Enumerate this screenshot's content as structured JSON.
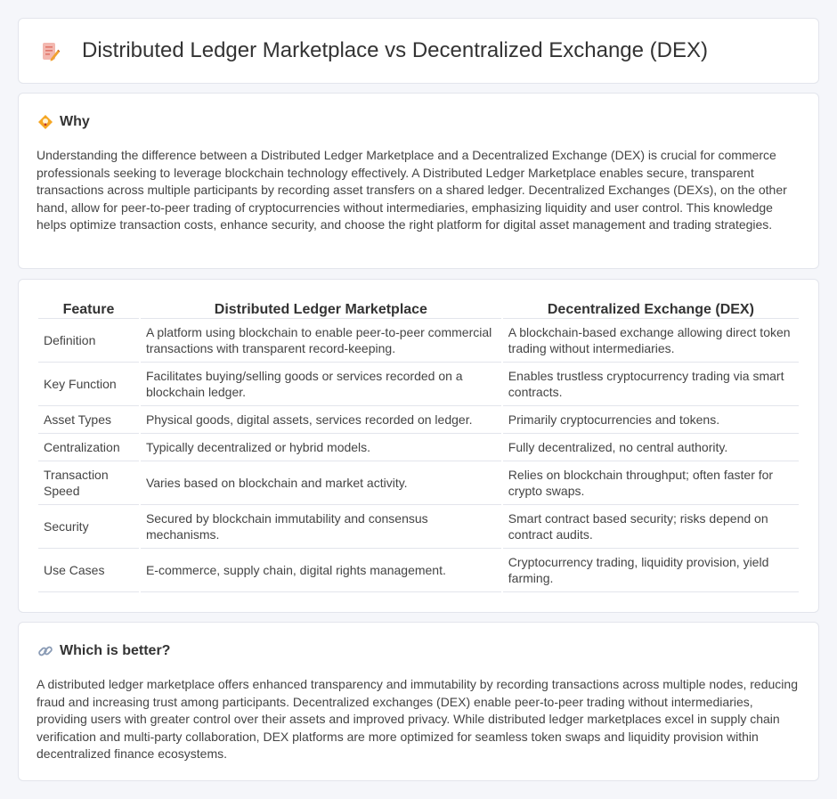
{
  "header": {
    "title": "Distributed Ledger Marketplace vs Decentralized Exchange (DEX)",
    "icon": "document-pencil-icon"
  },
  "why": {
    "title": "Why",
    "icon": "diamond-lightbulb-icon",
    "text": "Understanding the difference between a Distributed Ledger Marketplace and a Decentralized Exchange (DEX) is crucial for commerce professionals seeking to leverage blockchain technology effectively. A Distributed Ledger Marketplace enables secure, transparent transactions across multiple participants by recording asset transfers on a shared ledger. Decentralized Exchanges (DEXs), on the other hand, allow for peer-to-peer trading of cryptocurrencies without intermediaries, emphasizing liquidity and user control. This knowledge helps optimize transaction costs, enhance security, and choose the right platform for digital asset management and trading strategies."
  },
  "table": {
    "headers": [
      "Feature",
      "Distributed Ledger Marketplace",
      "Decentralized Exchange (DEX)"
    ],
    "rows": [
      {
        "feature": "Definition",
        "dlm": "A platform using blockchain to enable peer-to-peer commercial transactions with transparent record-keeping.",
        "dex": "A blockchain-based exchange allowing direct token trading without intermediaries."
      },
      {
        "feature": "Key Function",
        "dlm": "Facilitates buying/selling goods or services recorded on a blockchain ledger.",
        "dex": "Enables trustless cryptocurrency trading via smart contracts."
      },
      {
        "feature": "Asset Types",
        "dlm": "Physical goods, digital assets, services recorded on ledger.",
        "dex": "Primarily cryptocurrencies and tokens."
      },
      {
        "feature": "Centralization",
        "dlm": "Typically decentralized or hybrid models.",
        "dex": "Fully decentralized, no central authority."
      },
      {
        "feature": "Transaction Speed",
        "dlm": "Varies based on blockchain and market activity.",
        "dex": "Relies on blockchain throughput; often faster for crypto swaps."
      },
      {
        "feature": "Security",
        "dlm": "Secured by blockchain immutability and consensus mechanisms.",
        "dex": "Smart contract based security; risks depend on contract audits."
      },
      {
        "feature": "Use Cases",
        "dlm": "E-commerce, supply chain, digital rights management.",
        "dex": "Cryptocurrency trading, liquidity provision, yield farming."
      }
    ]
  },
  "better": {
    "title": "Which is better?",
    "icon": "link-icon",
    "text": "A distributed ledger marketplace offers enhanced transparency and immutability by recording transactions across multiple nodes, reducing fraud and increasing trust among participants. Decentralized exchanges (DEX) enable peer-to-peer trading without intermediaries, providing users with greater control over their assets and improved privacy. While distributed ledger marketplaces excel in supply chain verification and multi-party collaboration, DEX platforms are more optimized for seamless token swaps and liquidity provision within decentralized finance ecosystems."
  }
}
